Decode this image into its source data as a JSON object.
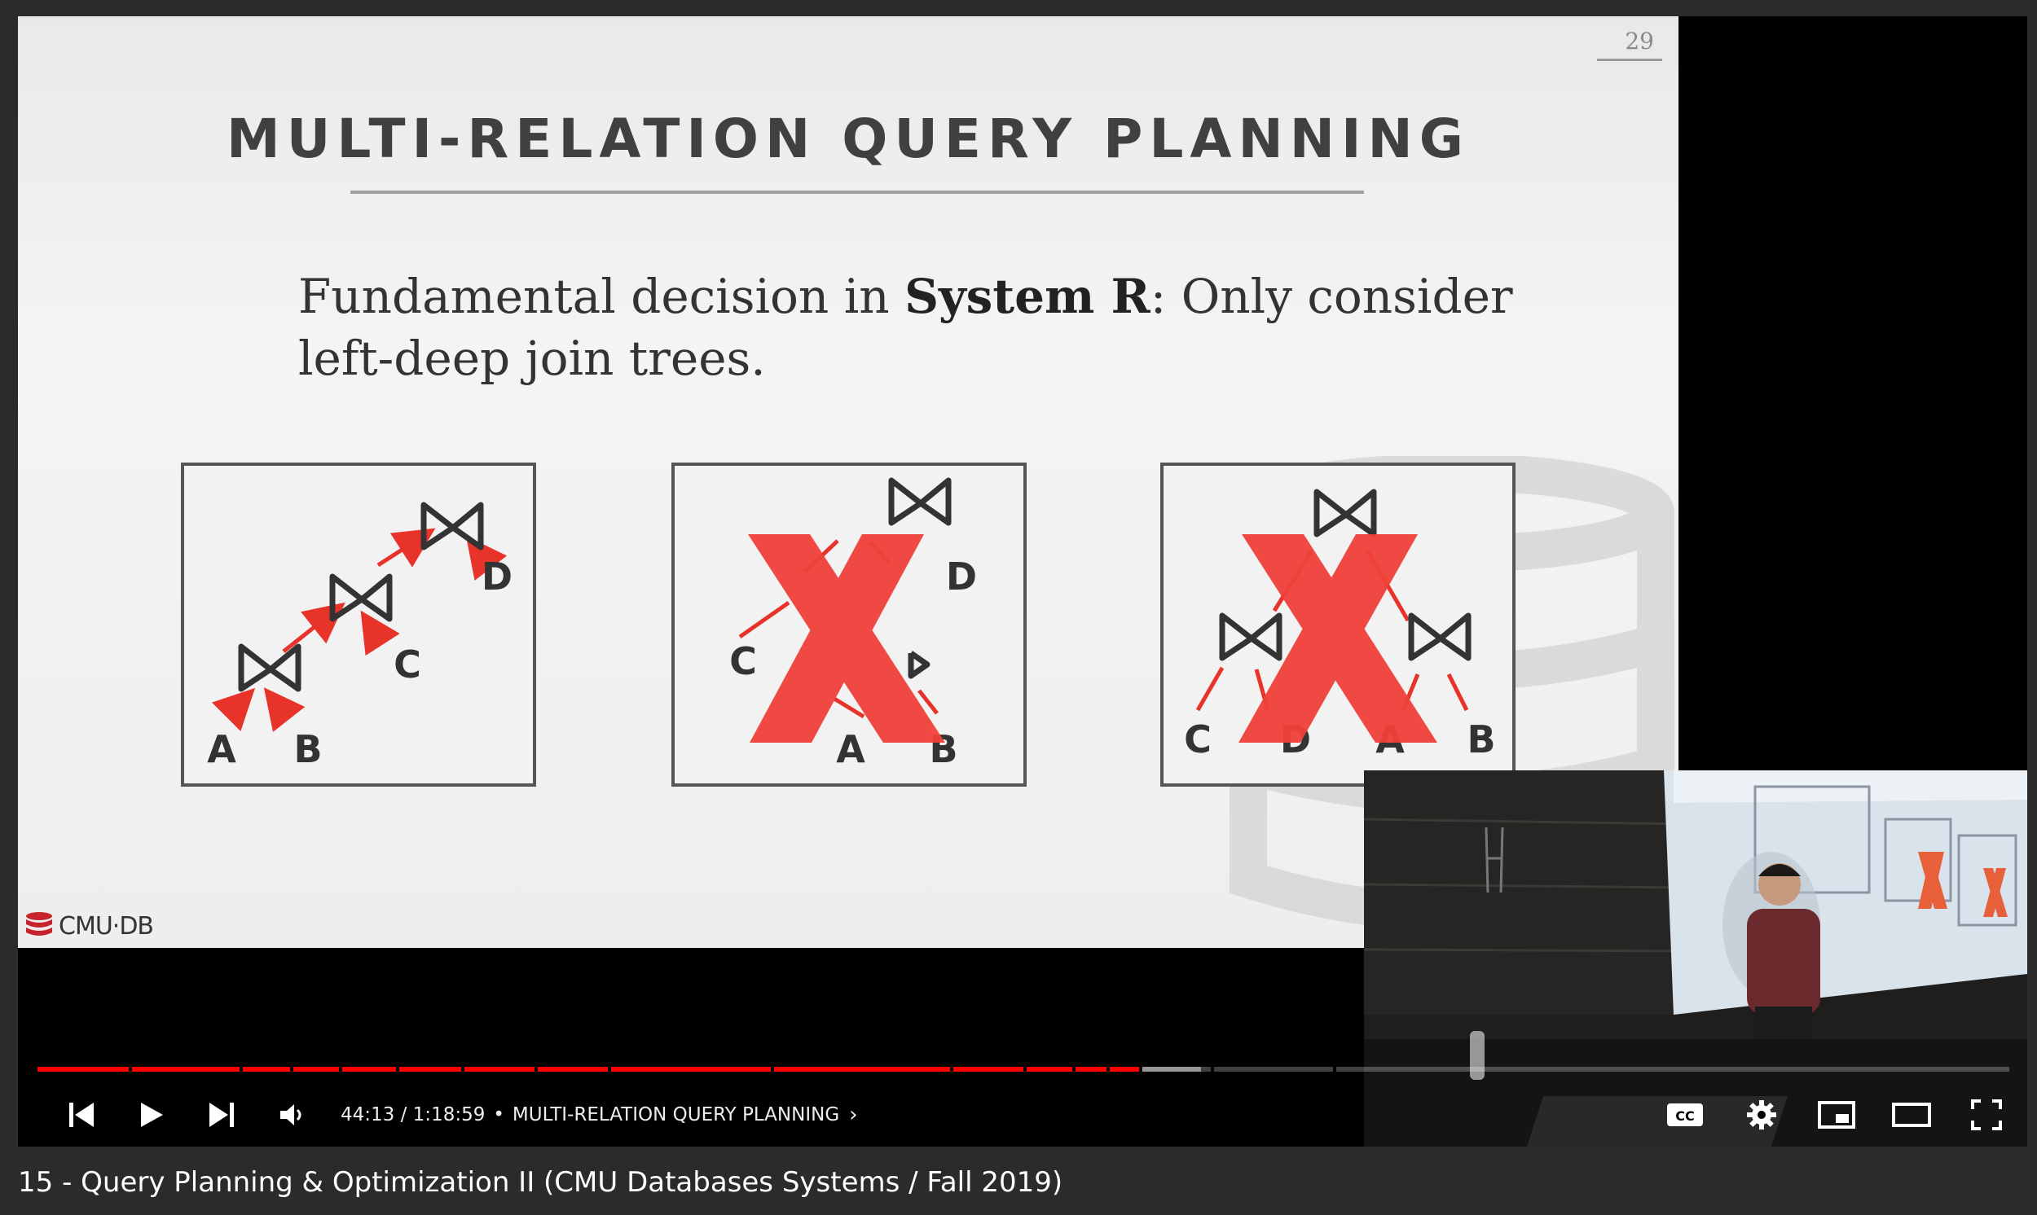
{
  "video": {
    "title": "15 - Query Planning & Optimization II (CMU Databases Systems / Fall 2019)"
  },
  "slide": {
    "page_number": "29",
    "title": "MULTI-RELATION QUERY PLANNING",
    "body_line1_pre": "Fundamental decision in ",
    "body_line1_bold": "System R",
    "body_line1_post": ": Only consider",
    "body_line2": "left-deep join trees.",
    "logo_text": "CMU·DB",
    "colors": {
      "arrow": "#e8332a",
      "cross": "#f0413a",
      "join_symbol": "#333333"
    },
    "trees": [
      {
        "shape": "left-deep",
        "crossed": false,
        "leaves": [
          "A",
          "B",
          "C",
          "D"
        ]
      },
      {
        "shape": "right-branching",
        "crossed": true,
        "leaves": [
          "C",
          "D",
          "A",
          "B"
        ]
      },
      {
        "shape": "bushy",
        "crossed": true,
        "leaves": [
          "C",
          "D",
          "A",
          "B"
        ]
      }
    ]
  },
  "player": {
    "progress": 0.56,
    "buffered": 0.59,
    "time_current": "44:13",
    "time_total": "1:18:59",
    "separator": "•",
    "chapter_title": "MULTI-RELATION QUERY PLANNING",
    "accent_color": "#ff0000",
    "icons": [
      "previous-icon",
      "play-icon",
      "next-icon",
      "volume-icon",
      "captions-icon",
      "settings-icon",
      "miniplayer-icon",
      "theater-mode-icon",
      "fullscreen-icon"
    ]
  }
}
